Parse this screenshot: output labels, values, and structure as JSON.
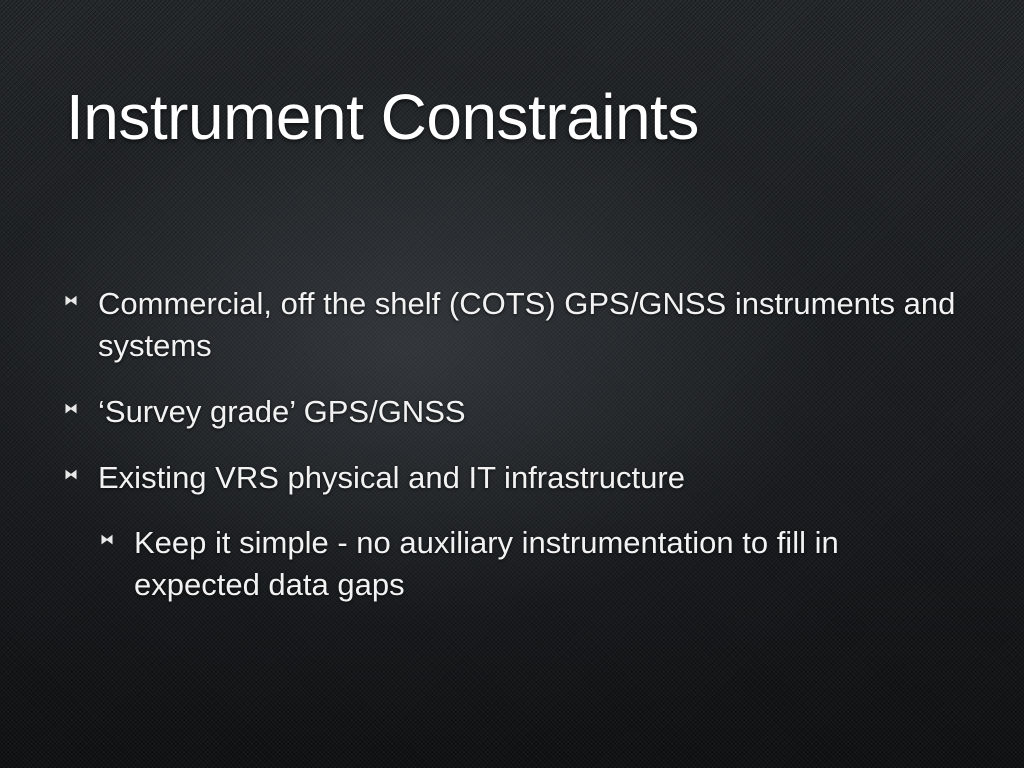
{
  "slide": {
    "title": "Instrument Constraints",
    "bullets": [
      {
        "text": "Commercial, off the shelf (COTS) GPS/GNSS instruments and systems",
        "level": 1
      },
      {
        "text": "‘Survey grade’ GPS/GNSS",
        "level": 1
      },
      {
        "text": "Existing VRS physical and IT infrastructure",
        "level": 1
      },
      {
        "text": "Keep it simple - no auxiliary instrumentation to fill in expected data gaps",
        "level": 2
      }
    ],
    "bullet_icon": "bowtie-bullet-icon",
    "colors": {
      "text": "#ffffff",
      "background": "#1b1e21"
    }
  }
}
